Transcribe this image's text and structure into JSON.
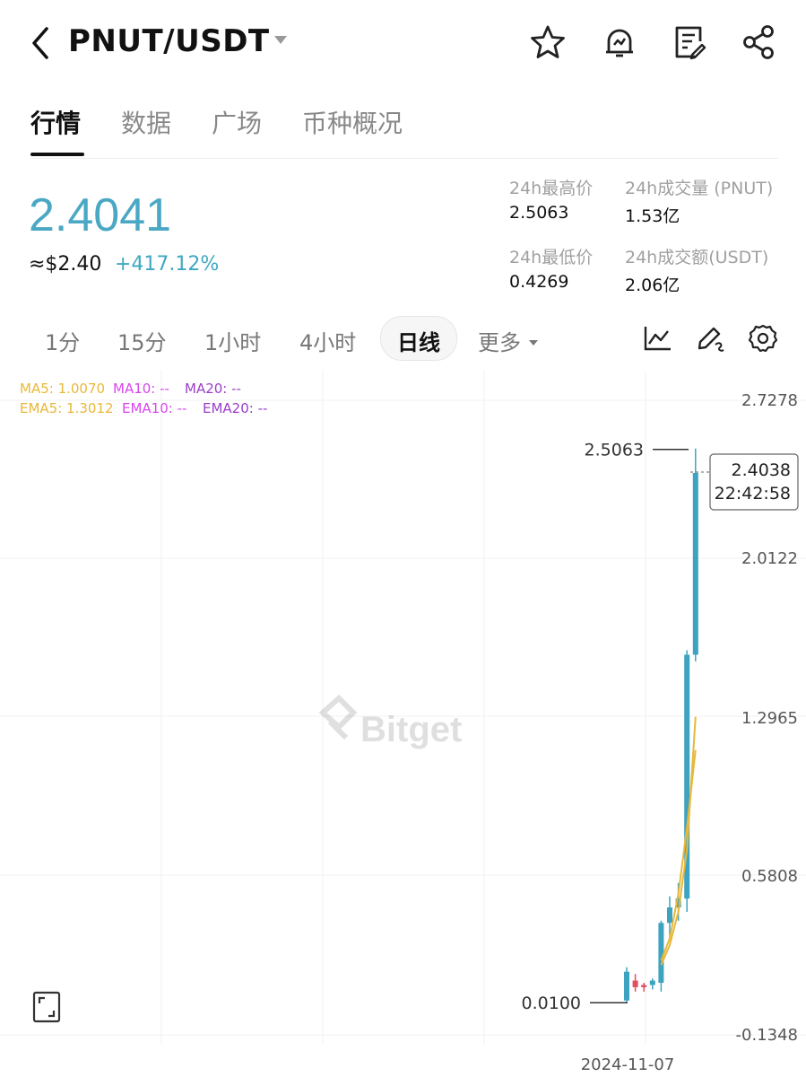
{
  "header": {
    "pair": "PNUT/USDT",
    "icons": [
      "back-arrow-icon",
      "caret-down-icon",
      "star-icon",
      "alert-bell-icon",
      "notes-icon",
      "share-icon"
    ]
  },
  "tabs": [
    {
      "label": "行情",
      "active": true
    },
    {
      "label": "数据",
      "active": false
    },
    {
      "label": "广场",
      "active": false
    },
    {
      "label": "币种概况",
      "active": false
    }
  ],
  "price": {
    "last": "2.4041",
    "usd": "≈$2.40",
    "change": "+417.12%"
  },
  "stats": {
    "high_label": "24h最高价",
    "high_value": "2.5063",
    "vol_label": "24h成交量 (PNUT)",
    "vol_value": "1.53亿",
    "low_label": "24h最低价",
    "low_value": "0.4269",
    "turnover_label": "24h成交额(USDT)",
    "turnover_value": "2.06亿"
  },
  "intervals": {
    "items": [
      "1分",
      "15分",
      "1小时",
      "4小时",
      "日线",
      "更多"
    ],
    "selected": "日线"
  },
  "chart_data": {
    "type": "candlestick",
    "watermark": "Bitget",
    "indicators": {
      "ma5": "MA5: 1.0070",
      "ma10": "MA10: --",
      "ma20": "MA20: --",
      "ema5": "EMA5: 1.3012",
      "ema10": "EMA10: --",
      "ema20": "EMA20: --"
    },
    "y_ticks": [
      "2.7278",
      "2.0122",
      "1.2965",
      "0.5808",
      "-0.1348"
    ],
    "x_tick": "2024-11-07",
    "high_marker": "2.5063",
    "low_marker": "0.0100",
    "current_price": "2.4038",
    "countdown": "22:42:58",
    "ylim": [
      -0.1348,
      2.7278
    ],
    "candles": [
      {
        "open": 0.02,
        "high": 0.17,
        "low": 0.01,
        "close": 0.15,
        "dir": "up"
      },
      {
        "open": 0.11,
        "high": 0.14,
        "low": 0.06,
        "close": 0.08,
        "dir": "down"
      },
      {
        "open": 0.08,
        "high": 0.1,
        "low": 0.06,
        "close": 0.09,
        "dir": "down"
      },
      {
        "open": 0.09,
        "high": 0.12,
        "low": 0.07,
        "close": 0.11,
        "dir": "up"
      },
      {
        "open": 0.1,
        "high": 0.38,
        "low": 0.06,
        "close": 0.37,
        "dir": "up"
      },
      {
        "open": 0.37,
        "high": 0.49,
        "low": 0.29,
        "close": 0.44,
        "dir": "up"
      },
      {
        "open": 0.44,
        "high": 0.55,
        "low": 0.38,
        "close": 0.48,
        "dir": "up"
      },
      {
        "open": 0.48,
        "high": 1.6,
        "low": 0.42,
        "close": 1.58,
        "dir": "up"
      },
      {
        "open": 1.58,
        "high": 2.51,
        "low": 1.55,
        "close": 2.4,
        "dir": "up"
      }
    ],
    "ma5_line": [
      [
        4,
        0.2
      ],
      [
        5,
        0.3
      ],
      [
        6,
        0.5
      ],
      [
        7,
        0.8
      ],
      [
        8,
        1.15
      ]
    ],
    "ema5_line": [
      [
        4,
        0.18
      ],
      [
        5,
        0.27
      ],
      [
        6,
        0.42
      ],
      [
        7,
        0.7
      ],
      [
        8,
        1.3
      ]
    ],
    "colors": {
      "up": "#3ea3c0",
      "down": "#e0505f",
      "ma5": "#e8b83a",
      "ma10": "#d946ef",
      "ma20": "#9b3ec8",
      "price": "#4aa8c4"
    }
  }
}
